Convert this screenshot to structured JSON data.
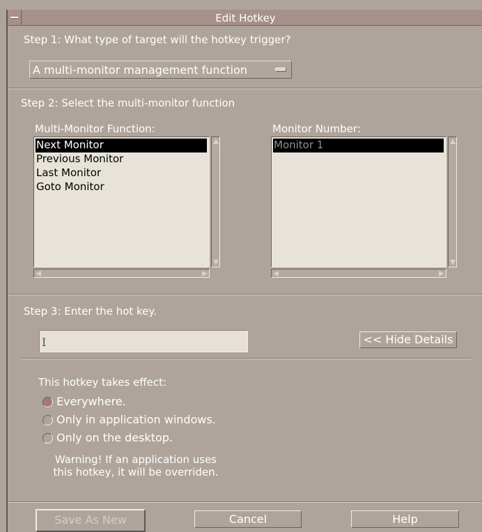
{
  "window": {
    "title": "Edit Hotkey"
  },
  "step1": {
    "label": "Step 1: What type of target will the hotkey trigger?",
    "selected": "A multi-monitor management function"
  },
  "step2": {
    "label": "Step 2: Select the multi-monitor function",
    "function_list": {
      "header": "Multi-Monitor Function:",
      "items": [
        "Next Monitor",
        "Previous Monitor",
        "Last Monitor",
        "Goto Monitor"
      ],
      "selected": "Next Monitor"
    },
    "monitor_list": {
      "header": "Monitor Number:",
      "items": [
        "Monitor 1"
      ],
      "selected": "Monitor 1"
    }
  },
  "step3": {
    "label": "Step 3: Enter the hot key.",
    "hotkey_value": "",
    "details_button": "<< Hide Details"
  },
  "scope": {
    "heading": "This hotkey takes effect:",
    "options": [
      "Everywhere.",
      "Only in application windows.",
      "Only on the desktop."
    ],
    "selected": "Everywhere.",
    "warning_line1": "Warning! If an application uses",
    "warning_line2": "this hotkey, it will be overriden."
  },
  "buttons": {
    "save_as_new": "Save As New",
    "cancel": "Cancel",
    "help": "Help"
  },
  "colors": {
    "background": "#aea49b",
    "titlebar": "#a7908a",
    "list_background": "#e7e3d8",
    "radio_selected": "#a67876"
  }
}
